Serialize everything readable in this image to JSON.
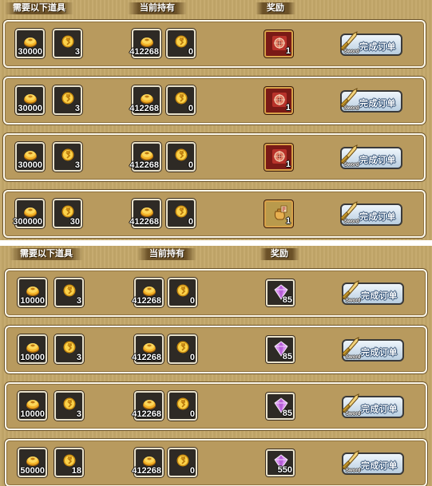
{
  "panels": [
    {
      "headers": {
        "required": "需要以下道具",
        "owned": "当前持有",
        "reward": "奖励"
      },
      "rows": [
        {
          "req_gold": "30000",
          "req_token": "3",
          "own_gold": "412268",
          "own_token": "0",
          "reward_icon": "red-chest-icon",
          "reward_qty": "1",
          "button": "完成订单",
          "button_sub": "Sword"
        },
        {
          "req_gold": "30000",
          "req_token": "3",
          "own_gold": "412268",
          "own_token": "0",
          "reward_icon": "red-chest-icon",
          "reward_qty": "1",
          "button": "完成订单",
          "button_sub": "Sword"
        },
        {
          "req_gold": "30000",
          "req_token": "3",
          "own_gold": "412268",
          "own_token": "0",
          "reward_icon": "red-chest-icon",
          "reward_qty": "1",
          "button": "完成订单",
          "button_sub": "Sword"
        },
        {
          "req_gold": "300000",
          "req_token": "30",
          "own_gold": "412268",
          "own_token": "0",
          "reward_icon": "treasure-bag-icon",
          "reward_qty": "1",
          "button": "完成订单",
          "button_sub": "Sword"
        }
      ]
    },
    {
      "headers": {
        "required": "需要以下道具",
        "owned": "当前持有",
        "reward": "奖励"
      },
      "rows": [
        {
          "req_gold": "10000",
          "req_token": "3",
          "own_gold": "412268",
          "own_token": "0",
          "reward_icon": "purple-gem-icon",
          "reward_qty": "85",
          "button": "完成订单",
          "button_sub": "Sword"
        },
        {
          "req_gold": "10000",
          "req_token": "3",
          "own_gold": "412268",
          "own_token": "0",
          "reward_icon": "purple-gem-icon",
          "reward_qty": "85",
          "button": "完成订单",
          "button_sub": "Sword"
        },
        {
          "req_gold": "10000",
          "req_token": "3",
          "own_gold": "412268",
          "own_token": "0",
          "reward_icon": "purple-gem-icon",
          "reward_qty": "85",
          "button": "完成订单",
          "button_sub": "Sword"
        },
        {
          "req_gold": "50000",
          "req_token": "18",
          "own_gold": "412268",
          "own_token": "0",
          "reward_icon": "purple-gem-icon",
          "reward_qty": "550",
          "button": "完成订单",
          "button_sub": "Sword"
        }
      ]
    }
  ]
}
